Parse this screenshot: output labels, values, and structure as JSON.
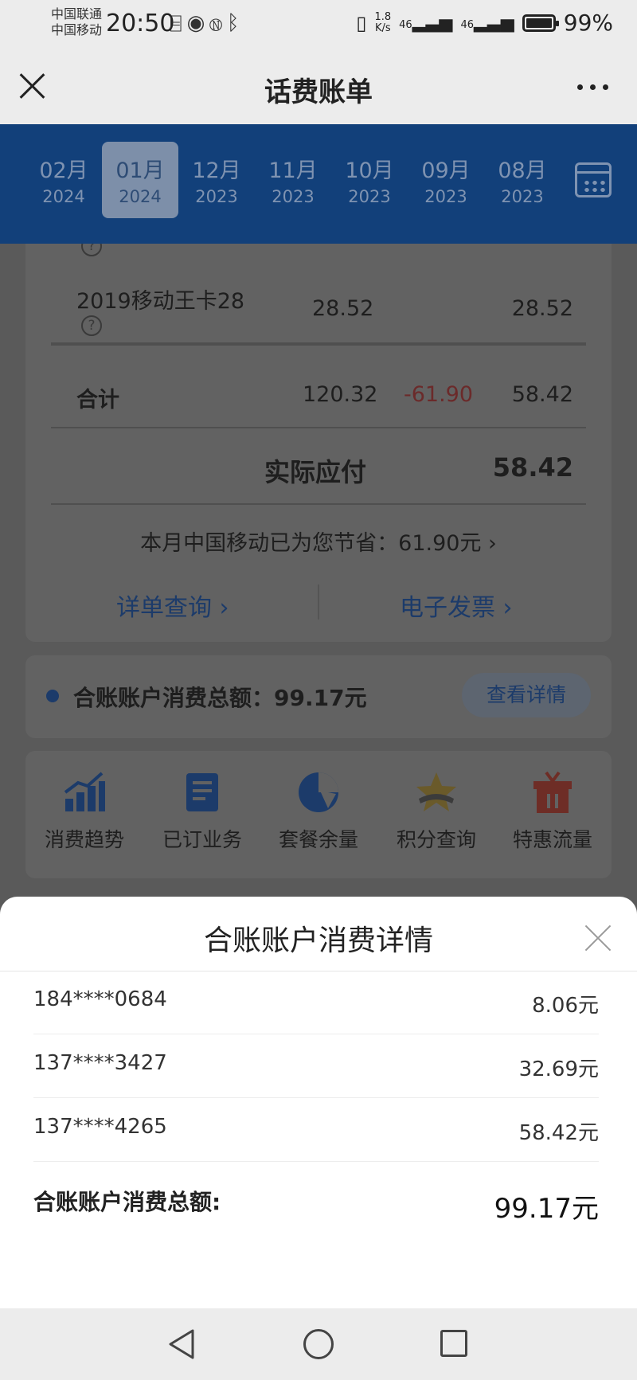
{
  "status_bar": {
    "carrier1": "中国联通",
    "carrier2": "中国移动",
    "time": "20:50",
    "net_speed_value": "1.8",
    "net_speed_unit": "K/s",
    "signal1": "46",
    "signal2": "46",
    "battery": "99%"
  },
  "titlebar": {
    "title": "话费账单"
  },
  "months": [
    {
      "month": "02月",
      "year": "2024",
      "active": false
    },
    {
      "month": "01月",
      "year": "2024",
      "active": true
    },
    {
      "month": "12月",
      "year": "2023",
      "active": false
    },
    {
      "month": "11月",
      "year": "2023",
      "active": false
    },
    {
      "month": "10月",
      "year": "2023",
      "active": false
    },
    {
      "month": "09月",
      "year": "2023",
      "active": false
    },
    {
      "month": "08月",
      "year": "2023",
      "active": false
    }
  ],
  "bill": {
    "plan_name": "2019移动王卡28",
    "plan_amount": "28.52",
    "plan_actual": "28.52",
    "total_label": "合计",
    "total_amount": "120.32",
    "total_discount": "-61.90",
    "total_actual": "58.42",
    "payable_label": "实际应付",
    "payable_value": "58.42",
    "saving_text": "本月中国移动已为您节省：61.90元",
    "detail_link": "详单查询",
    "invoice_link": "电子发票"
  },
  "combined": {
    "summary": "合账账户消费总额：99.17元",
    "view_button": "查看详情"
  },
  "quick_actions": [
    {
      "label": "消费趋势",
      "icon": "trend-chart-icon"
    },
    {
      "label": "已订业务",
      "icon": "subscribed-icon"
    },
    {
      "label": "套餐余量",
      "icon": "pie-chart-icon"
    },
    {
      "label": "积分查询",
      "icon": "star-icon"
    },
    {
      "label": "特惠流量",
      "icon": "gift-icon"
    }
  ],
  "sheet": {
    "title": "合账账户消费详情",
    "accounts": [
      {
        "number": "184****0684",
        "amount": "8.06元"
      },
      {
        "number": "137****3427",
        "amount": "32.69元"
      },
      {
        "number": "137****4265",
        "amount": "58.42元"
      }
    ],
    "total_label": "合账账户消费总额:",
    "total_value": "99.17元"
  },
  "colors": {
    "month_bar": "#12407a",
    "discount_red": "#6b2a2a",
    "link_blue": "#1c3b6a",
    "overlay_gray": "#5a5a5a"
  }
}
